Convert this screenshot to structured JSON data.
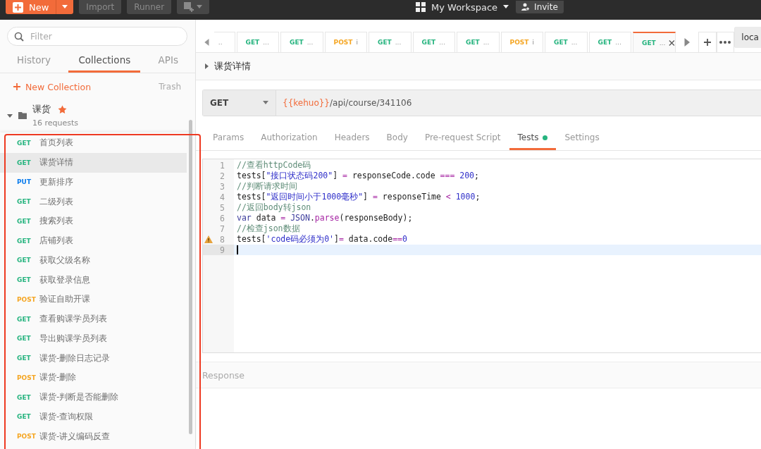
{
  "toolbar": {
    "new_button": "New",
    "import_button": "Import",
    "runner_button": "Runner",
    "workspace": "My Workspace",
    "invite_button": "Invite"
  },
  "sidebar": {
    "filter_placeholder": "Filter",
    "tabs": [
      {
        "label": "History",
        "selected": false
      },
      {
        "label": "Collections",
        "selected": true
      },
      {
        "label": "APIs",
        "selected": false
      }
    ],
    "new_collection": "New Collection",
    "trash": "Trash",
    "collection": {
      "name": "课货",
      "starred": true,
      "expanded": true,
      "count": "16 requests",
      "requests": [
        {
          "method": "GET",
          "name": "首页列表",
          "selected": false
        },
        {
          "method": "GET",
          "name": "课货详情",
          "selected": true
        },
        {
          "method": "PUT",
          "name": "更新排序",
          "selected": false
        },
        {
          "method": "GET",
          "name": "二级列表",
          "selected": false
        },
        {
          "method": "GET",
          "name": "搜索列表",
          "selected": false
        },
        {
          "method": "GET",
          "name": "店铺列表",
          "selected": false
        },
        {
          "method": "GET",
          "name": "获取父级名称",
          "selected": false
        },
        {
          "method": "GET",
          "name": "获取登录信息",
          "selected": false
        },
        {
          "method": "POST",
          "name": "验证自助开课",
          "selected": false
        },
        {
          "method": "GET",
          "name": "查看购课学员列表",
          "selected": false
        },
        {
          "method": "GET",
          "name": "导出购课学员列表",
          "selected": false
        },
        {
          "method": "GET",
          "name": "课货-删除日志记录",
          "selected": false
        },
        {
          "method": "POST",
          "name": "课货-删除",
          "selected": false
        },
        {
          "method": "GET",
          "name": "课货-判断是否能删除",
          "selected": false
        },
        {
          "method": "GET",
          "name": "课货-查询权限",
          "selected": false
        },
        {
          "method": "POST",
          "name": "课货-讲义编码反查",
          "selected": false
        }
      ]
    }
  },
  "request_tabs": [
    {
      "kind": "partial",
      "label": "..",
      "selected": false
    },
    {
      "method": "GET",
      "label": "...",
      "selected": false
    },
    {
      "method": "GET",
      "label": "...",
      "selected": false
    },
    {
      "method": "POST",
      "label": "i",
      "selected": false
    },
    {
      "method": "GET",
      "label": "...",
      "selected": false
    },
    {
      "method": "GET",
      "label": "...",
      "selected": false
    },
    {
      "method": "GET",
      "label": "...",
      "selected": false
    },
    {
      "method": "POST",
      "label": "i",
      "selected": false
    },
    {
      "method": "GET",
      "label": "...",
      "selected": false
    },
    {
      "method": "GET",
      "label": "...",
      "selected": false
    },
    {
      "method": "GET",
      "label": "...",
      "selected": true
    }
  ],
  "environment": "loca",
  "request": {
    "title": "课货详情",
    "method": "GET",
    "url_variable": "{{kehuo}}",
    "url_path": "/api/course/341106",
    "tabs": [
      {
        "label": "Params",
        "selected": false,
        "has_content": false
      },
      {
        "label": "Authorization",
        "selected": false,
        "has_content": false
      },
      {
        "label": "Headers",
        "selected": false,
        "has_content": false
      },
      {
        "label": "Body",
        "selected": false,
        "has_content": false
      },
      {
        "label": "Pre-request Script",
        "selected": false,
        "has_content": false
      },
      {
        "label": "Tests",
        "selected": true,
        "has_content": true
      },
      {
        "label": "Settings",
        "selected": false,
        "has_content": false
      }
    ],
    "code": [
      {
        "number": "1",
        "warning": false,
        "current": false,
        "tokens": [
          {
            "kind": "comment",
            "text": "//查看httpCode码"
          }
        ]
      },
      {
        "number": "2",
        "warning": false,
        "current": false,
        "tokens": [
          {
            "kind": "plain",
            "text": "tests["
          },
          {
            "kind": "string",
            "text": "\"接口状态码200\""
          },
          {
            "kind": "plain",
            "text": "] "
          },
          {
            "kind": "operator",
            "text": "="
          },
          {
            "kind": "plain",
            "text": " responseCode.code "
          },
          {
            "kind": "operator",
            "text": "=== "
          },
          {
            "kind": "number",
            "text": "200"
          },
          {
            "kind": "plain",
            "text": ";"
          }
        ]
      },
      {
        "number": "3",
        "warning": false,
        "current": false,
        "tokens": [
          {
            "kind": "comment",
            "text": "//判断请求时间"
          }
        ]
      },
      {
        "number": "4",
        "warning": false,
        "current": false,
        "tokens": [
          {
            "kind": "plain",
            "text": "tests["
          },
          {
            "kind": "string",
            "text": "\"返回时间小于1000毫秒\""
          },
          {
            "kind": "plain",
            "text": "] "
          },
          {
            "kind": "operator",
            "text": "="
          },
          {
            "kind": "plain",
            "text": " responseTime "
          },
          {
            "kind": "operator",
            "text": "< "
          },
          {
            "kind": "number",
            "text": "1000"
          },
          {
            "kind": "plain",
            "text": ";"
          }
        ]
      },
      {
        "number": "5",
        "warning": false,
        "current": false,
        "tokens": [
          {
            "kind": "comment",
            "text": "//返回body转json"
          }
        ]
      },
      {
        "number": "6",
        "warning": false,
        "current": false,
        "tokens": [
          {
            "kind": "keyword",
            "text": "var"
          },
          {
            "kind": "plain",
            "text": " data "
          },
          {
            "kind": "operator",
            "text": "= "
          },
          {
            "kind": "keyword",
            "text": "JSON"
          },
          {
            "kind": "plain",
            "text": "."
          },
          {
            "kind": "function",
            "text": "parse"
          },
          {
            "kind": "plain",
            "text": "(responseBody);"
          }
        ]
      },
      {
        "number": "7",
        "warning": false,
        "current": false,
        "tokens": [
          {
            "kind": "comment",
            "text": "//检查json数据"
          }
        ]
      },
      {
        "number": "8",
        "warning": true,
        "current": false,
        "tokens": [
          {
            "kind": "plain",
            "text": "tests["
          },
          {
            "kind": "string",
            "text": "'code码必须为0'"
          },
          {
            "kind": "plain",
            "text": "]"
          },
          {
            "kind": "operator",
            "text": "="
          },
          {
            "kind": "plain",
            "text": " data.code"
          },
          {
            "kind": "operator",
            "text": "=="
          },
          {
            "kind": "number",
            "text": "0"
          }
        ]
      },
      {
        "number": "9",
        "warning": false,
        "current": true
      }
    ]
  },
  "response": {
    "title": "Response"
  }
}
